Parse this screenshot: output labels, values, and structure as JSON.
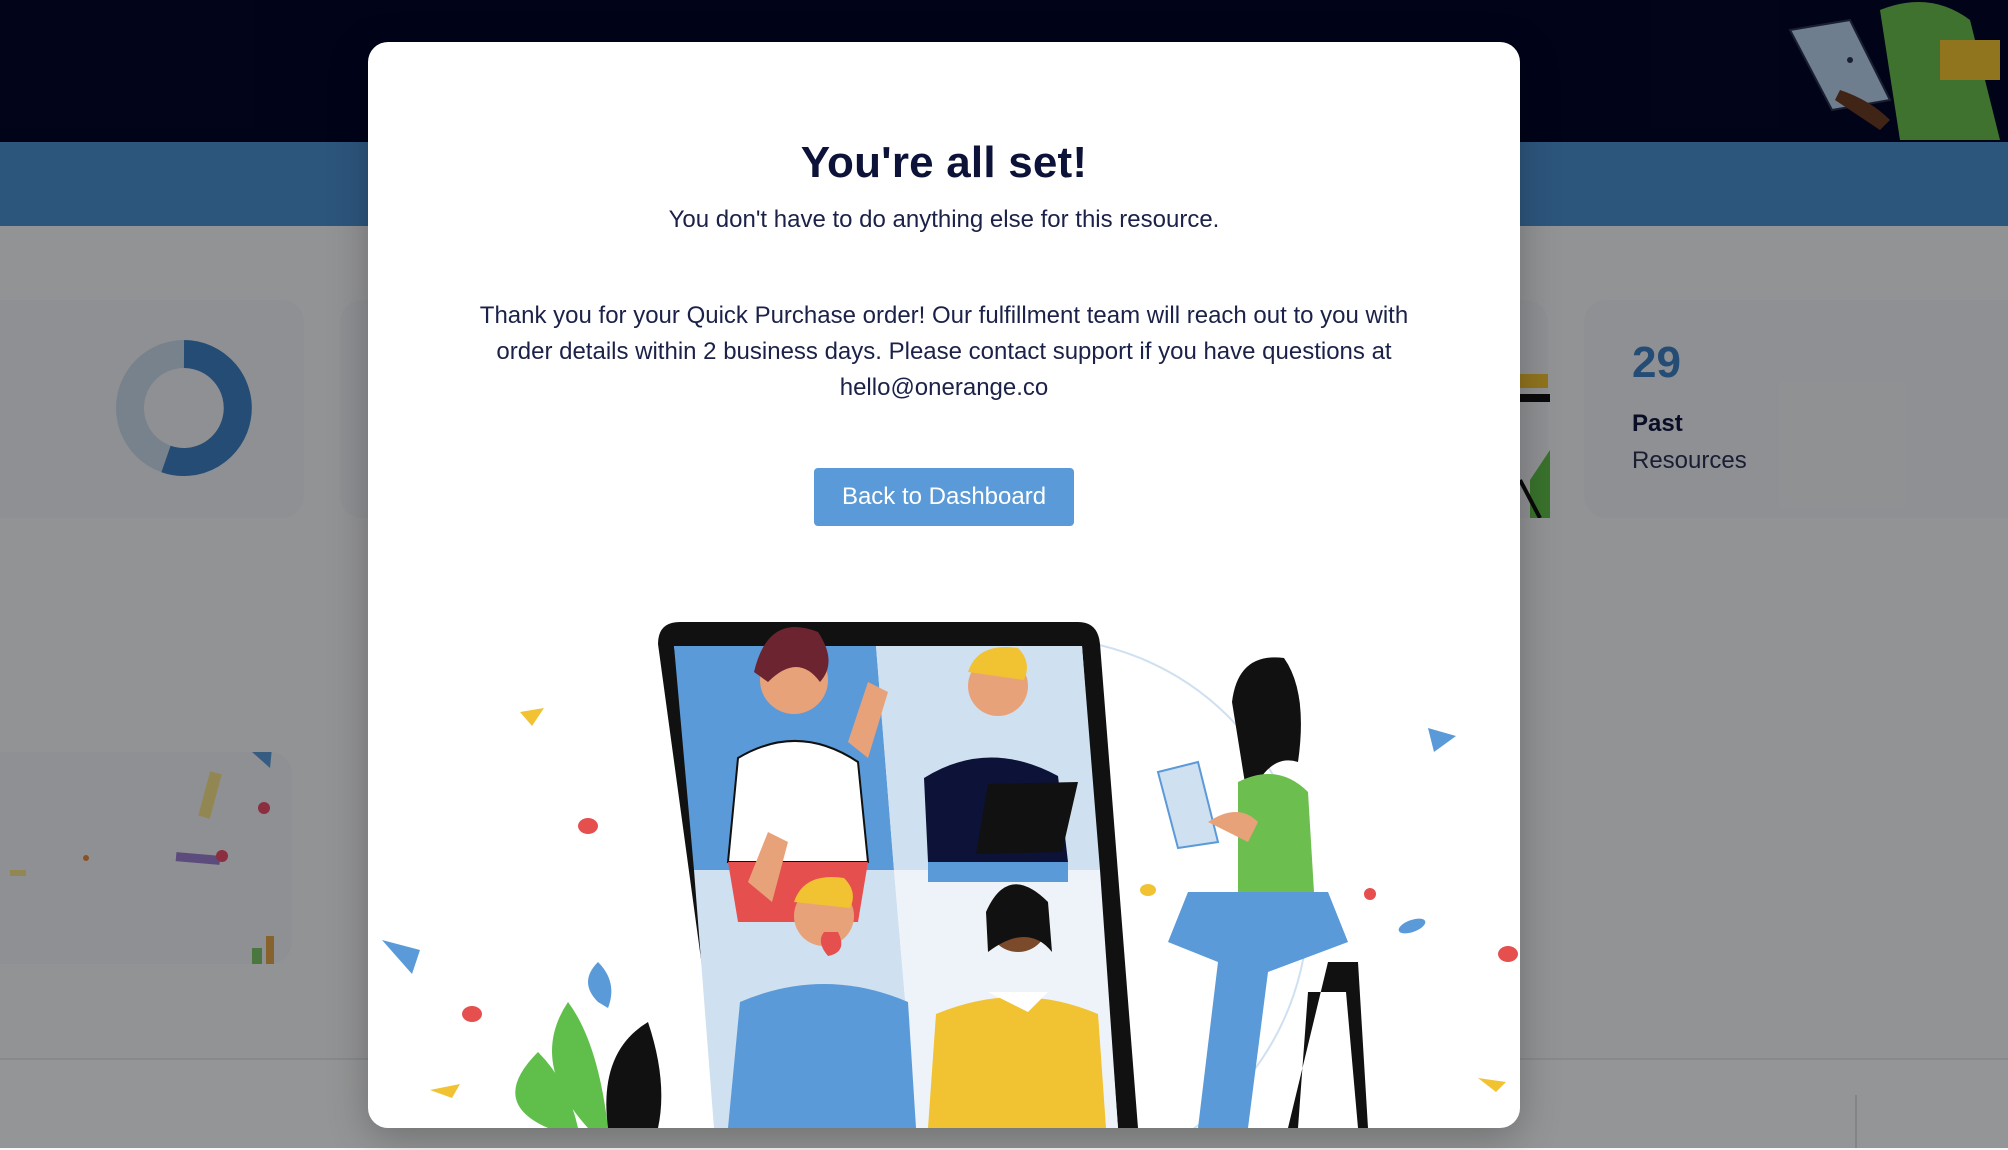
{
  "background": {
    "stat_card": {
      "number": "29",
      "label": "Past",
      "sublabel": "Resources"
    }
  },
  "modal": {
    "title": "You're all set!",
    "subtitle": "You don't have to do anything else for this resource.",
    "body": "Thank you for your Quick Purchase order! Our fulfillment team will reach out to you with order details within 2 business days. Please contact support if you have questions at hello@onerange.co",
    "back_button_label": "Back to Dashboard"
  },
  "colors": {
    "navy_header": "#03082a",
    "blue_subheader": "#4b8fd0",
    "button_blue": "#5a9ad8",
    "title_text": "#0c1238"
  }
}
